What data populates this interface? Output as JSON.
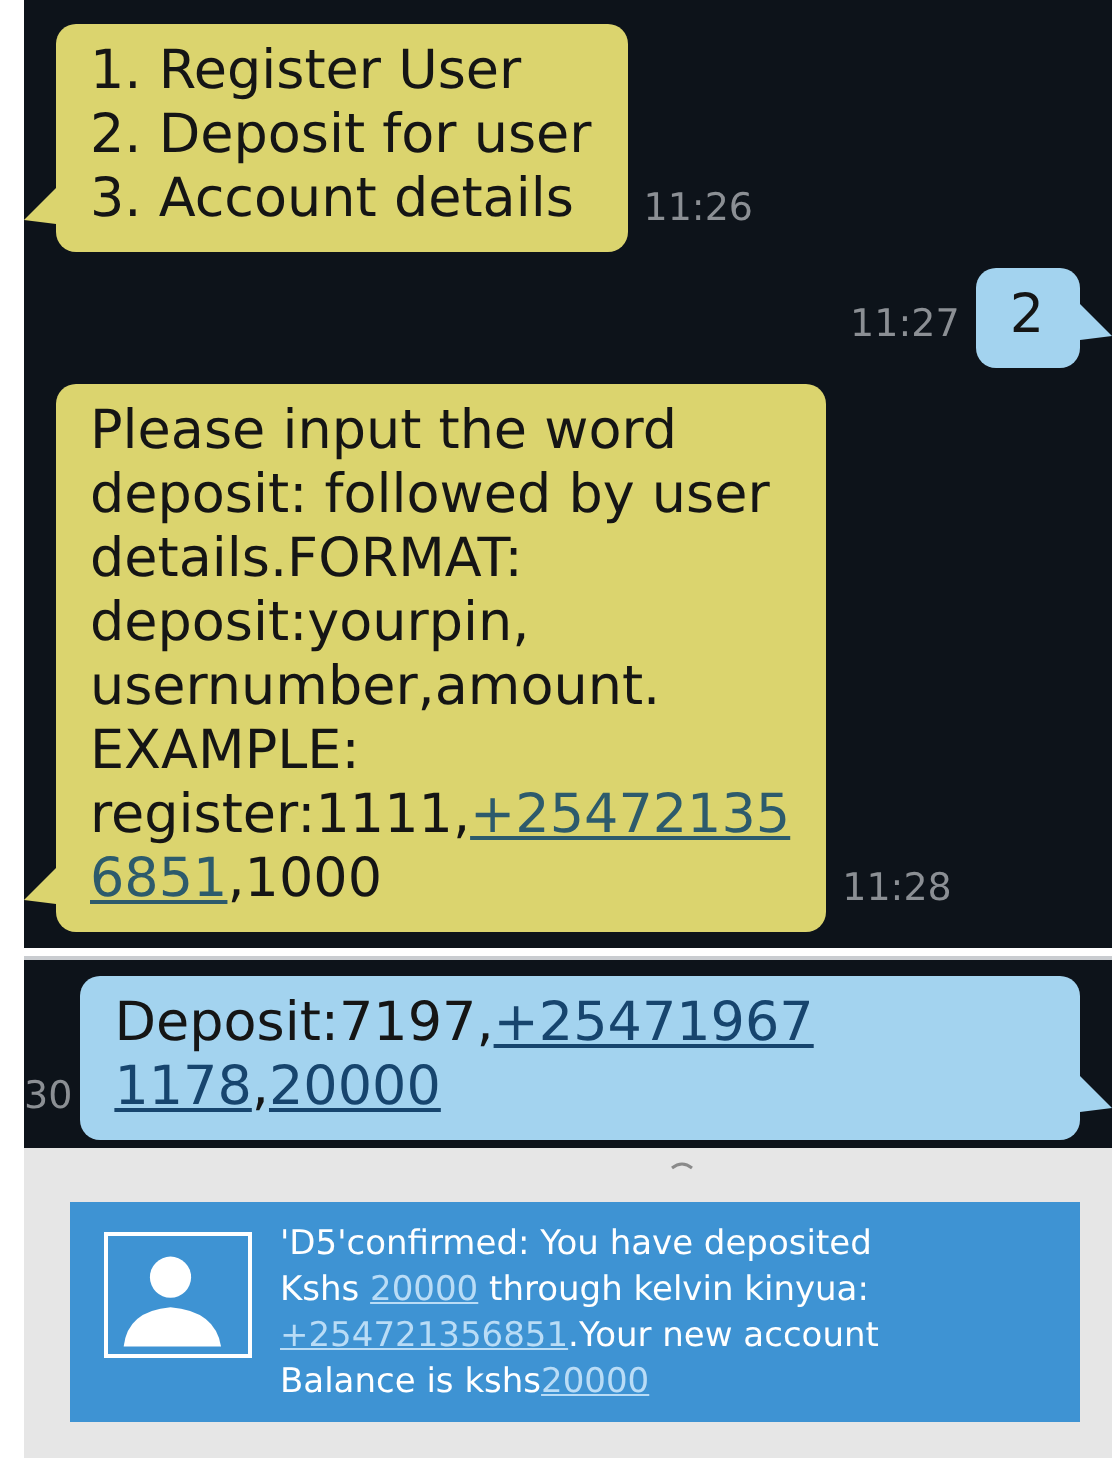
{
  "threads": [
    {
      "messages": [
        {
          "kind": "received",
          "time": "11:26",
          "lines": [
            [
              {
                "kind": "text",
                "text": "1. Register User"
              }
            ],
            [
              {
                "kind": "text",
                "text": "2. Deposit for user"
              }
            ],
            [
              {
                "kind": "text",
                "text": "3. Account details"
              }
            ]
          ]
        },
        {
          "kind": "sent",
          "time": "11:27",
          "lines": [
            [
              {
                "kind": "text",
                "text": "2"
              }
            ]
          ]
        },
        {
          "kind": "received",
          "time": "11:28",
          "lines": [
            [
              {
                "kind": "text",
                "text": "Please input the word"
              }
            ],
            [
              {
                "kind": "text",
                "text": "deposit: followed by user"
              }
            ],
            [
              {
                "kind": "text",
                "text": "details.FORMAT:"
              }
            ],
            [
              {
                "kind": "text",
                "text": "deposit:yourpin,"
              }
            ],
            [
              {
                "kind": "text",
                "text": "usernumber,amount."
              }
            ],
            [
              {
                "kind": "text",
                "text": "EXAMPLE:"
              }
            ],
            [
              {
                "kind": "text",
                "text": "register:1111,"
              },
              {
                "kind": "link",
                "text": "+25472135"
              }
            ],
            [
              {
                "kind": "link",
                "text": "6851"
              },
              {
                "kind": "text",
                "text": ",1000"
              }
            ]
          ]
        }
      ]
    },
    {
      "messages": [
        {
          "kind": "sent",
          "time": "30",
          "lines": [
            [
              {
                "kind": "text",
                "text": "Deposit:7197,"
              },
              {
                "kind": "link",
                "text": "+25471967"
              }
            ],
            [
              {
                "kind": "link",
                "text": "1178"
              },
              {
                "kind": "text",
                "text": ","
              },
              {
                "kind": "link",
                "text": "20000"
              }
            ]
          ]
        }
      ]
    }
  ],
  "notification": {
    "lines": [
      [
        {
          "kind": "text",
          "text": "'D5'confirmed: You have deposited"
        }
      ],
      [
        {
          "kind": "text",
          "text": "Kshs "
        },
        {
          "kind": "link",
          "text": "20000"
        },
        {
          "kind": "text",
          "text": " through kelvin kinyua:"
        }
      ],
      [
        {
          "kind": "link",
          "text": "+254721356851"
        },
        {
          "kind": "text",
          "text": ".Your new account"
        }
      ],
      [
        {
          "kind": "text",
          "text": "Balance is kshs"
        },
        {
          "kind": "link",
          "text": "20000"
        }
      ]
    ]
  }
}
